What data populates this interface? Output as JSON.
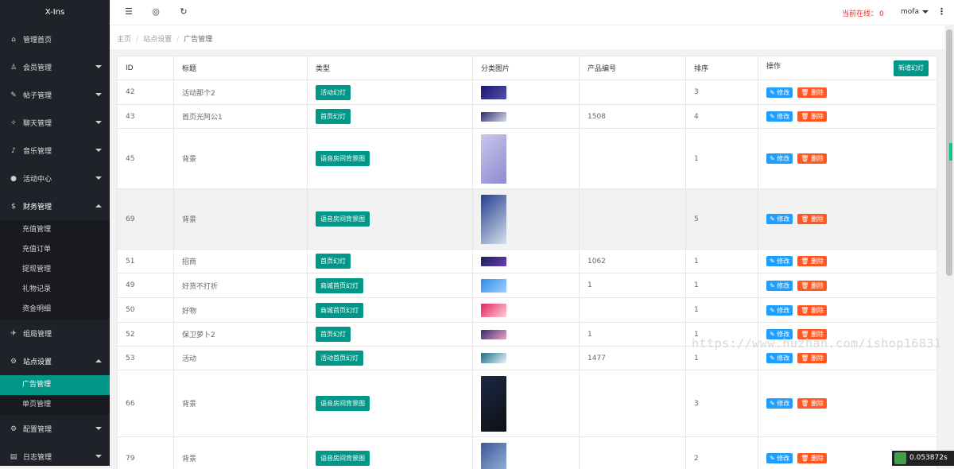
{
  "app_title": "X-Ins",
  "sidebar": {
    "items": [
      {
        "label": "管理首页",
        "icon": "home-icon"
      },
      {
        "label": "会员管理",
        "icon": "user-icon",
        "arrow": "down"
      },
      {
        "label": "帖子管理",
        "icon": "post-icon",
        "arrow": "down"
      },
      {
        "label": "聊天管理",
        "icon": "chat-icon",
        "arrow": "down"
      },
      {
        "label": "音乐管理",
        "icon": "music-icon",
        "arrow": "down"
      },
      {
        "label": "活动中心",
        "icon": "activity-icon",
        "arrow": "down"
      },
      {
        "label": "财务管理",
        "icon": "finance-icon",
        "arrow": "up"
      }
    ],
    "finance_sub": [
      "充值管理",
      "充值订单",
      "提现管理",
      "礼物记录",
      "资金明细"
    ],
    "items2": [
      {
        "label": "组局管理",
        "icon": "group-icon"
      },
      {
        "label": "站点设置",
        "icon": "settings-icon",
        "arrow": "up"
      }
    ],
    "site_sub": [
      "广告管理",
      "单页管理"
    ],
    "items3": [
      {
        "label": "配置管理",
        "icon": "config-icon",
        "arrow": "down"
      },
      {
        "label": "日志管理",
        "icon": "log-icon",
        "arrow": "down"
      }
    ]
  },
  "topbar": {
    "online_label": "当前在线：",
    "online_count": "0",
    "username": "mofa"
  },
  "breadcrumb": {
    "home": "主页",
    "section": "站点设置",
    "current": "广告管理"
  },
  "table": {
    "headers": [
      "ID",
      "标题",
      "类型",
      "分类图片",
      "产品编号",
      "排序",
      "操作"
    ],
    "add_button": "新增幻灯",
    "edit_label": "修改",
    "delete_label": "删除",
    "rows": [
      {
        "id": "42",
        "title": "活动那个2",
        "type": "活动幻灯",
        "code": "",
        "sort": "3",
        "img": {
          "h": 17,
          "c1": "#1c1a6b",
          "c2": "#4f4fb0"
        }
      },
      {
        "id": "43",
        "title": "首页光阿公1",
        "type": "首页幻灯",
        "code": "1508",
        "sort": "4",
        "img": {
          "h": 12,
          "c1": "#2a2f6d",
          "c2": "#d9d9e6"
        }
      },
      {
        "id": "45",
        "title": "背景",
        "type": "语音房间背景图",
        "code": "",
        "sort": "1",
        "img": {
          "h": 62,
          "c1": "#c9c6ec",
          "c2": "#8f8bd0"
        }
      },
      {
        "id": "69",
        "title": "背景",
        "type": "语音房间背景图",
        "code": "",
        "sort": "5",
        "img": {
          "h": 62,
          "c1": "#243f8c",
          "c2": "#d7dff0"
        }
      },
      {
        "id": "51",
        "title": "招商",
        "type": "首页幻灯",
        "code": "1062",
        "sort": "1",
        "img": {
          "h": 12,
          "c1": "#1d1d55",
          "c2": "#6a3fb3"
        }
      },
      {
        "id": "49",
        "title": "好货不打折",
        "type": "商城首页幻灯",
        "code": "1",
        "sort": "1",
        "img": {
          "h": 17,
          "c1": "#2f8be8",
          "c2": "#9fd1ff"
        }
      },
      {
        "id": "50",
        "title": "好物",
        "type": "商城首页幻灯",
        "code": "",
        "sort": "1",
        "img": {
          "h": 17,
          "c1": "#e0245e",
          "c2": "#ffd1de"
        }
      },
      {
        "id": "52",
        "title": "保卫萝卜2",
        "type": "首页幻灯",
        "code": "1",
        "sort": "1",
        "img": {
          "h": 12,
          "c1": "#3a2a6b",
          "c2": "#e7a4c8"
        }
      },
      {
        "id": "53",
        "title": "活动",
        "type": "活动首页幻灯",
        "code": "1477",
        "sort": "1",
        "img": {
          "h": 13,
          "c1": "#1b6c8c",
          "c2": "#e9f4f8"
        }
      },
      {
        "id": "66",
        "title": "背景",
        "type": "语音房间背景图",
        "code": "",
        "sort": "3",
        "img": {
          "h": 70,
          "c1": "#1c2a44",
          "c2": "#0d0f14"
        }
      },
      {
        "id": "79",
        "title": "背景",
        "type": "语音房间背景图",
        "code": "",
        "sort": "2",
        "img": {
          "h": 40,
          "c1": "#3a5a9a",
          "c2": "#9ab4d8"
        }
      }
    ]
  },
  "watermark": "https://www.huzhan.com/ishop16831",
  "timer": "0.053872s",
  "colors": {
    "accent": "#009688",
    "edit": "#1e9fff",
    "delete": "#ff5722",
    "online": "#ff2222"
  }
}
